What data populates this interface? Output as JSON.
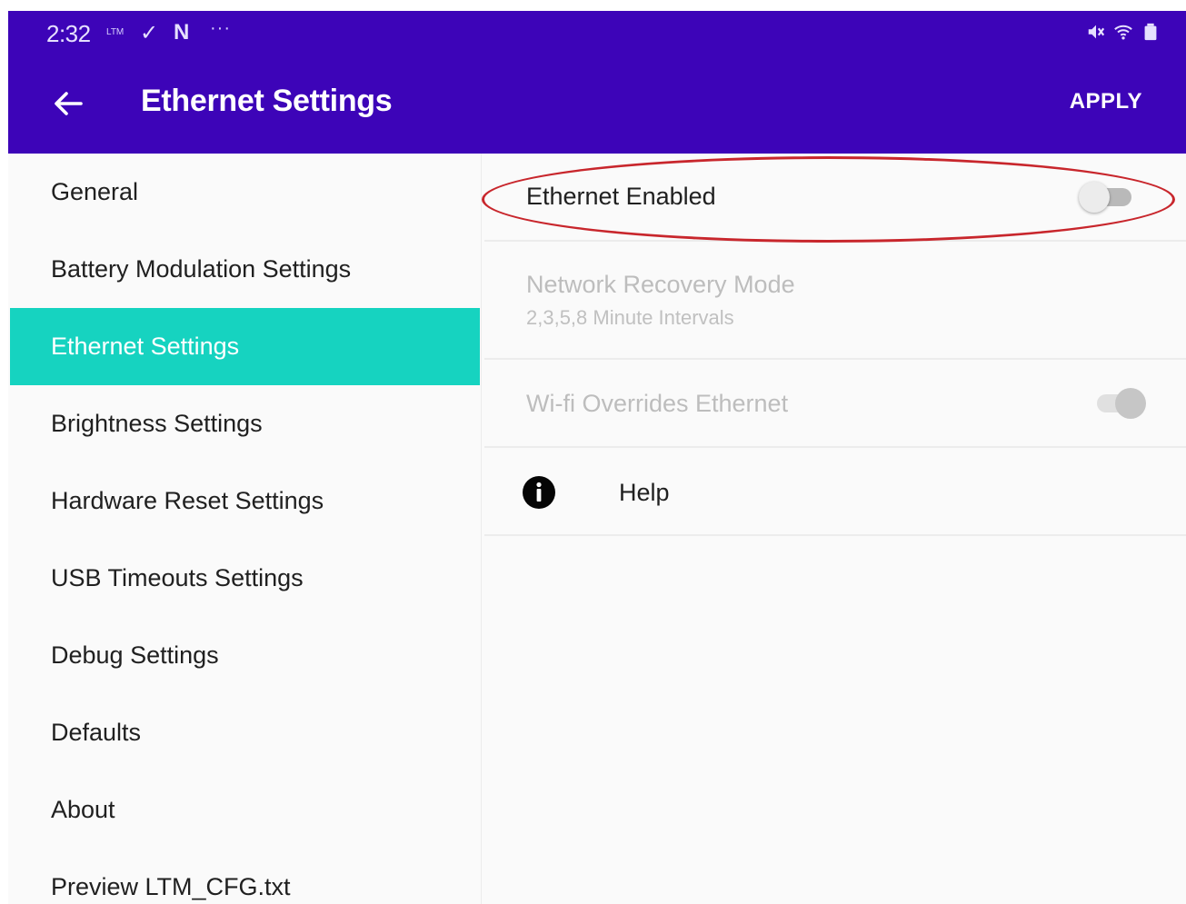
{
  "status_bar": {
    "time": "2:32",
    "carrier": "LTM",
    "dots": "···"
  },
  "app_bar": {
    "title": "Ethernet Settings",
    "apply_label": "APPLY"
  },
  "sidebar": {
    "items": [
      {
        "label": "General",
        "active": false
      },
      {
        "label": "Battery Modulation Settings",
        "active": false
      },
      {
        "label": "Ethernet Settings",
        "active": true
      },
      {
        "label": "Brightness Settings",
        "active": false
      },
      {
        "label": "Hardware Reset Settings",
        "active": false
      },
      {
        "label": "USB Timeouts Settings",
        "active": false
      },
      {
        "label": "Debug Settings",
        "active": false
      },
      {
        "label": "Defaults",
        "active": false
      },
      {
        "label": "About",
        "active": false
      },
      {
        "label": "Preview LTM_CFG.txt",
        "active": false
      }
    ]
  },
  "settings": {
    "ethernet_enabled": {
      "label": "Ethernet Enabled",
      "on": false
    },
    "network_recovery": {
      "label": "Network Recovery Mode",
      "summary": "2,3,5,8 Minute Intervals",
      "enabled": false
    },
    "wifi_overrides": {
      "label": "Wi-fi Overrides Ethernet",
      "on": true,
      "enabled": false
    },
    "help": {
      "label": "Help"
    }
  },
  "colors": {
    "app_bar": "#3d04b8",
    "active_item": "#16d3c0",
    "highlight": "#c8262c"
  },
  "icons": {
    "back": "arrow-back-icon",
    "info": "info-icon",
    "mute": "mute-icon",
    "wifi": "wifi-icon",
    "battery": "battery-icon"
  }
}
